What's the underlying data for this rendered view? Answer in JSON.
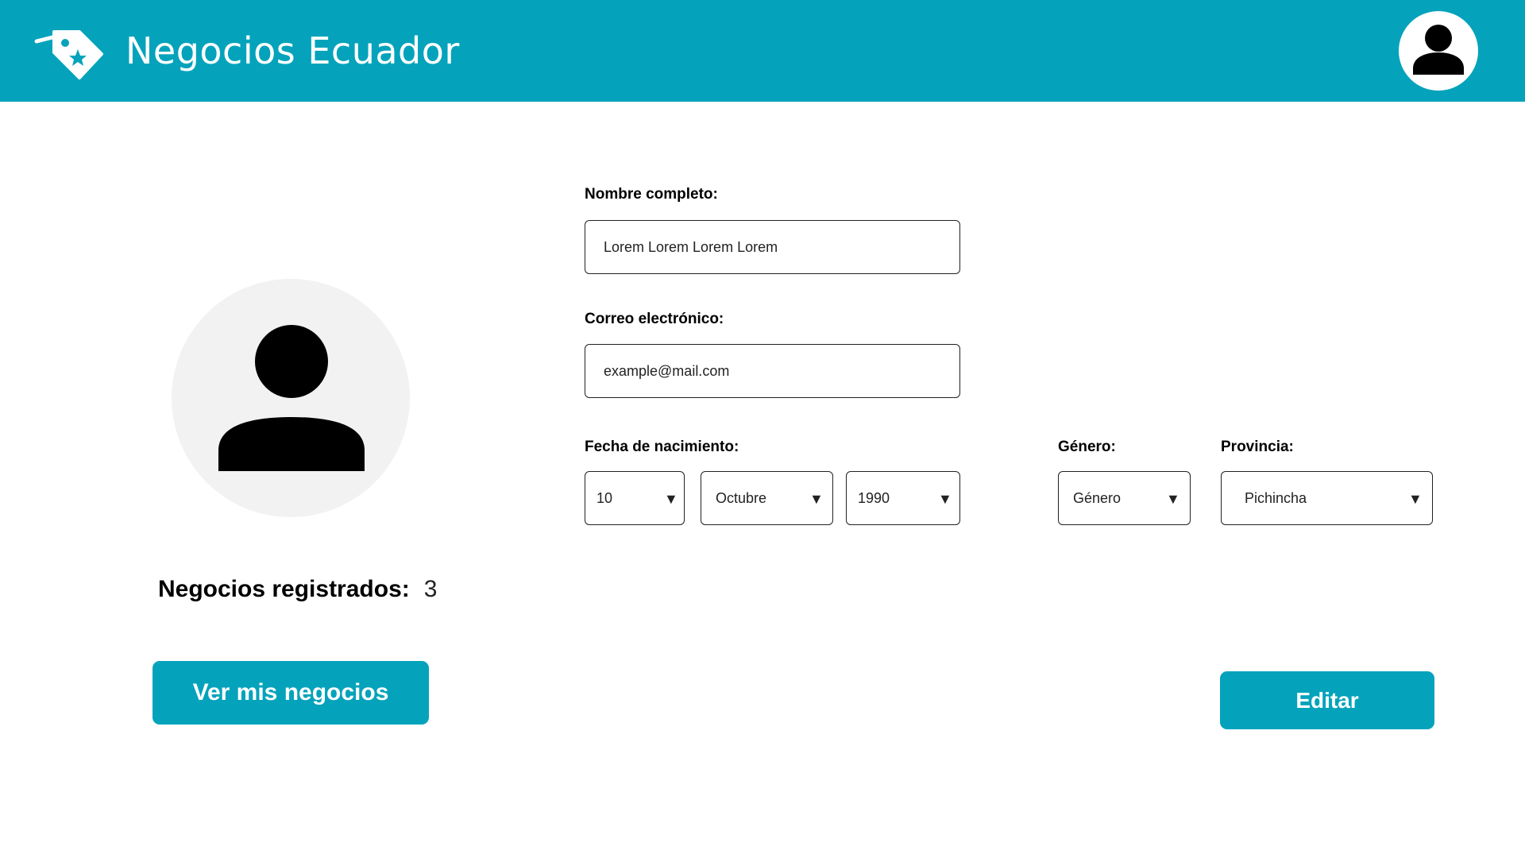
{
  "header": {
    "app_title": "Negocios Ecuador",
    "logo_icon": "tag-star-icon",
    "avatar_icon": "user-icon",
    "brand_color": "#04a3bb"
  },
  "profile": {
    "photo_icon": "user-icon",
    "registered_label": "Negocios registrados:",
    "registered_count": "3",
    "view_button": "Ver mis negocios"
  },
  "form": {
    "name_label": "Nombre completo:",
    "name_value": "Lorem Lorem Lorem Lorem",
    "email_label": "Correo electrónico:",
    "email_value": "example@mail.com",
    "birth_label": "Fecha de nacimiento:",
    "birth_day": "10",
    "birth_month": "Octubre",
    "birth_year": "1990",
    "gender_label": "Género:",
    "gender_value": "Género",
    "province_label": "Provincia:",
    "province_value": "Pichincha",
    "caret": "▼",
    "edit_button": "Editar"
  }
}
